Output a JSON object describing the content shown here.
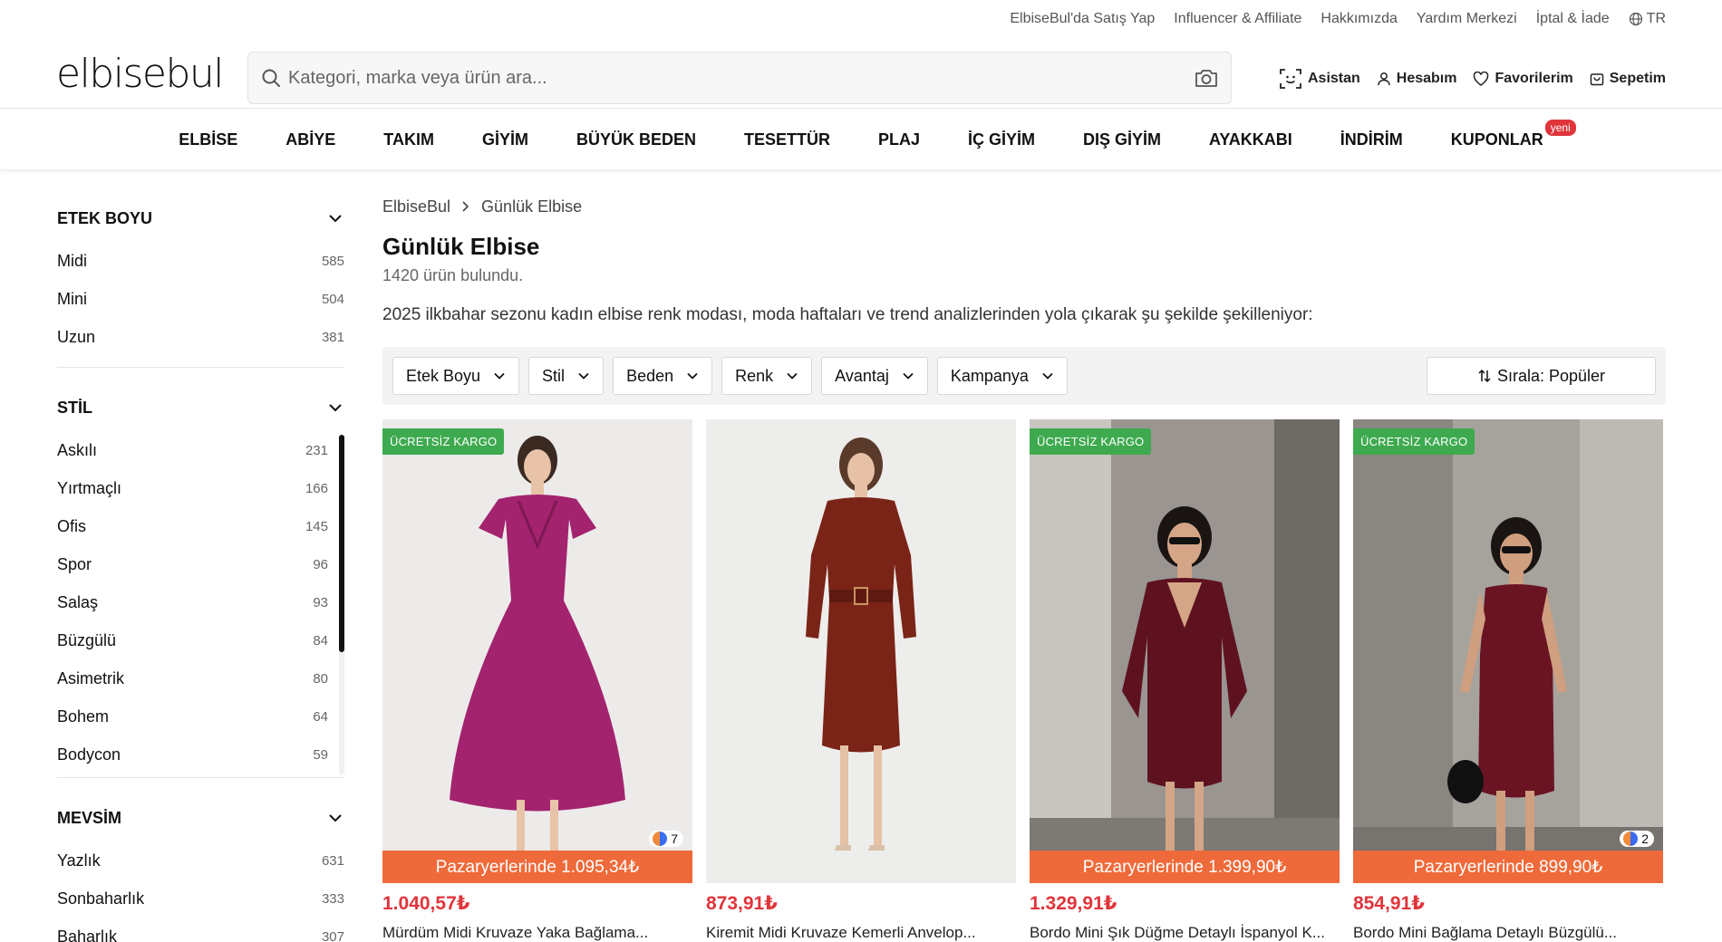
{
  "topbar": {
    "links": [
      "ElbiseBul'da Satış Yap",
      "Influencer & Affiliate",
      "Hakkımızda",
      "Yardım Merkezi",
      "İptal & İade"
    ],
    "lang": "TR"
  },
  "header": {
    "logo": "elbisebul",
    "search_placeholder": "Kategori, marka veya ürün ara...",
    "actions": {
      "assistant": "Asistan",
      "account": "Hesabım",
      "favorites": "Favorilerim",
      "cart": "Sepetim"
    }
  },
  "nav": {
    "items": [
      "ELBİSE",
      "ABİYE",
      "TAKIM",
      "GİYİM",
      "BÜYÜK BEDEN",
      "TESETTÜR",
      "PLAJ",
      "İÇ GİYİM",
      "DIŞ GİYİM",
      "AYAKKABI",
      "İNDİRİM",
      "KUPONLAR"
    ],
    "new_badge": "yeni"
  },
  "sidebar": {
    "sections": [
      {
        "title": "ETEK BOYU",
        "items": [
          {
            "label": "Midi",
            "count": "585"
          },
          {
            "label": "Mini",
            "count": "504"
          },
          {
            "label": "Uzun",
            "count": "381"
          }
        ]
      },
      {
        "title": "STİL",
        "items": [
          {
            "label": "Askılı",
            "count": "231"
          },
          {
            "label": "Yırtmaçlı",
            "count": "166"
          },
          {
            "label": "Ofis",
            "count": "145"
          },
          {
            "label": "Spor",
            "count": "96"
          },
          {
            "label": "Salaş",
            "count": "93"
          },
          {
            "label": "Büzgülü",
            "count": "84"
          },
          {
            "label": "Asimetrik",
            "count": "80"
          },
          {
            "label": "Bohem",
            "count": "64"
          },
          {
            "label": "Bodycon",
            "count": "59"
          }
        ]
      },
      {
        "title": "MEVSİM",
        "items": [
          {
            "label": "Yazlık",
            "count": "631"
          },
          {
            "label": "Sonbaharlık",
            "count": "333"
          },
          {
            "label": "Baharlık",
            "count": "307"
          }
        ]
      }
    ]
  },
  "main": {
    "breadcrumb": [
      "ElbiseBul",
      "Günlük Elbise"
    ],
    "title": "Günlük Elbise",
    "count": "1420 ürün bulundu.",
    "description": "2025 ilkbahar sezonu kadın elbise renk modası, moda haftaları ve trend analizlerinden yola çıkarak şu şekilde şekilleniyor:",
    "filters": [
      "Etek Boyu",
      "Stil",
      "Beden",
      "Renk",
      "Avantaj",
      "Kampanya"
    ],
    "sort_label": "Sırala: Popüler"
  },
  "products": [
    {
      "badge": "ÜCRETSİZ KARGO",
      "colors_count": "7",
      "market_price": "Pazaryerlerinde 1.095,34₺",
      "price": "1.040,57₺",
      "name": "Mürdüm Midi Kruvaze Yaka Bağlama...",
      "dress_color": "#a3236f",
      "bg_color": "#ecebea"
    },
    {
      "badge": "",
      "colors_count": "",
      "market_price": "",
      "price": "873,91₺",
      "name": "Kiremit Midi Kruvaze Kemerli Anvelop...",
      "dress_color": "#7a2417",
      "bg_color": "#ededeb"
    },
    {
      "badge": "ÜCRETSİZ KARGO",
      "colors_count": "",
      "market_price": "Pazaryerlerinde 1.399,90₺",
      "price": "1.329,91₺",
      "name": "Bordo Mini Şık Düğme Detaylı İspanyol K...",
      "dress_color": "#5e1220",
      "bg_color": "#9a9591"
    },
    {
      "badge": "ÜCRETSİZ KARGO",
      "colors_count": "2",
      "market_price": "Pazaryerlerinde 899,90₺",
      "price": "854,91₺",
      "name": "Bordo Mini Bağlama Detaylı Büzgülü...",
      "dress_color": "#6a1423",
      "bg_color": "#a6a29c"
    }
  ],
  "colors": {
    "accent": "#e0353b",
    "kargo": "#3eaa4f",
    "market": "#ef6a3a"
  }
}
